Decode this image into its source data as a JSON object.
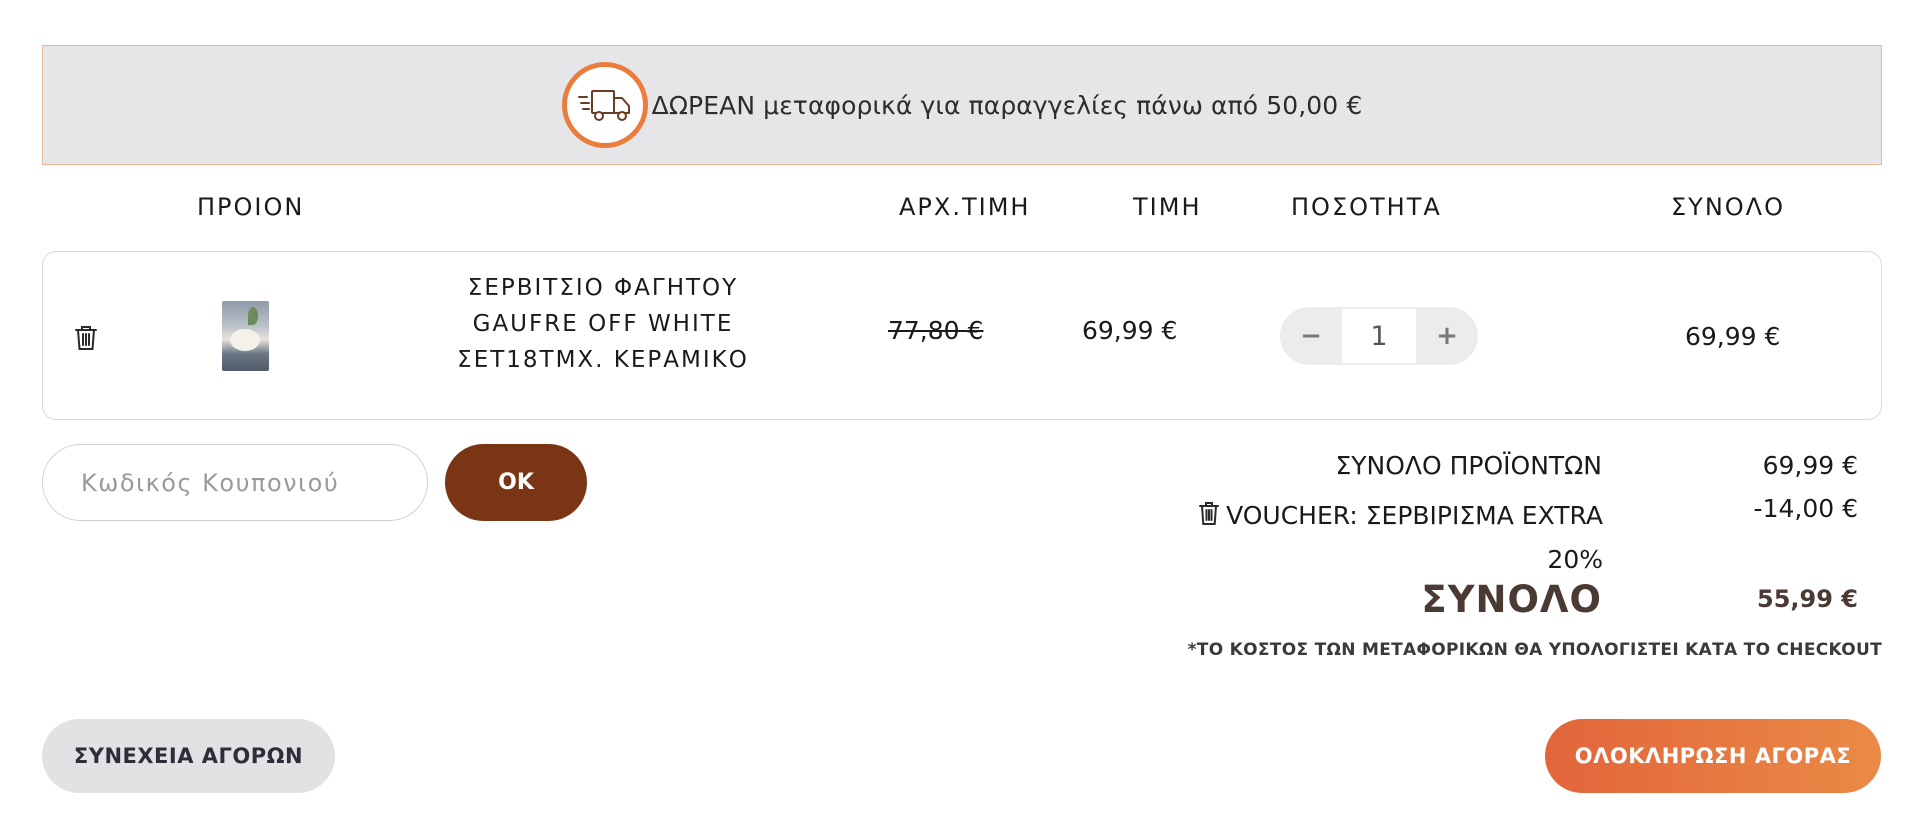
{
  "banner": {
    "icon": "delivery-truck-icon",
    "text": "ΔΩΡΕΑΝ μεταφορικά για παραγγελίες πάνω από 50,00 €"
  },
  "table_headers": {
    "product": "ΠΡΟΙΟΝ",
    "original_price": "ΑΡΧ.ΤΙΜΗ",
    "price": "ΤΙΜΗ",
    "quantity": "ΠΟΣΟΤΗΤΑ",
    "total": "ΣΥΝΟΛΟ"
  },
  "cart_item": {
    "remove_icon": "trash-icon",
    "name_lines": [
      "ΣΕΡΒΙΤΣΙΟ ΦΑΓΗΤΟΥ",
      "GAUFRE OFF WHITE",
      "ΣΕΤ18ΤΜΧ. ΚΕΡΑΜΙΚΟ"
    ],
    "original_price": "77,80 €",
    "price": "69,99 €",
    "quantity": "1",
    "minus_label": "−",
    "plus_label": "+",
    "total": "69,99 €"
  },
  "coupon": {
    "placeholder": "Κωδικός Κουπονιού",
    "value": "",
    "button_label": "OK"
  },
  "summary": {
    "products_total_label": "ΣΥΝΟΛΟ ΠΡΟΪΟΝΤΩΝ",
    "products_total_value": "69,99 €",
    "voucher_label": "VOUCHER: ΣΕΡΒΙΡΙΣΜΑ EXTRA 20%",
    "voucher_value": "-14,00 €",
    "total_label": "ΣΥΝΟΛΟ",
    "total_value": "55,99 €",
    "shipping_note": "*ΤΟ ΚΟΣΤΟΣ ΤΩΝ ΜΕΤΑΦΟΡΙΚΩΝ ΘΑ ΥΠΟΛΟΓΙΣΤΕΙ ΚΑΤΑ ΤΟ CHECKOUT"
  },
  "actions": {
    "continue_shopping": "ΣΥΝΕΧΕΙΑ ΑΓΟΡΩΝ",
    "checkout": "ΟΛΟΚΛΗΡΩΣΗ ΑΓΟΡΑΣ"
  },
  "colors": {
    "accent_orange": "#ec7c3c",
    "ok_brown": "#7a3515",
    "checkout_gradient_start": "#e2653a",
    "checkout_gradient_end": "#ea8a46",
    "banner_bg": "#e6e6e8"
  }
}
